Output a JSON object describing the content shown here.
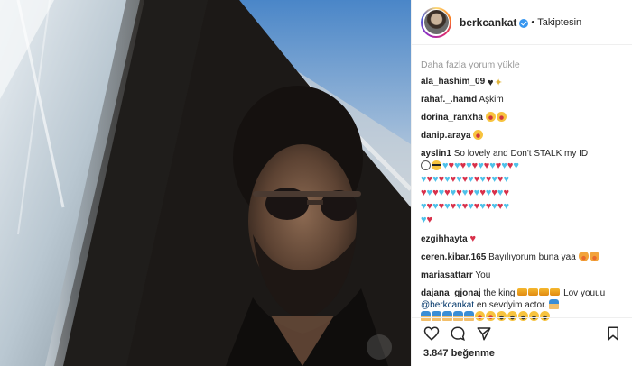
{
  "post": {
    "username": "berkcankat",
    "follow_status": "Takiptesin",
    "likes": "3.847 beğenme"
  },
  "comments_more": "Daha fazla yorum yükle",
  "comments": [
    {
      "user": "ala_hashim_09",
      "text": ""
    },
    {
      "user": "rahaf._.hamd",
      "text": "Aşkim"
    },
    {
      "user": "dorina_ranxha",
      "text": ""
    },
    {
      "user": "danip.araya",
      "text": ""
    },
    {
      "user": "ayslin1",
      "text": "So lovely and Don't STALK my ID"
    },
    {
      "user": "ezgihhayta",
      "text": ""
    },
    {
      "user": "ceren.kibar.165",
      "text": "Bayılıyorum buna yaa"
    },
    {
      "user": "mariasattarr",
      "text": "You"
    },
    {
      "user": "dajana_gjonaj",
      "text": "the king",
      "text2": "Lov youuu",
      "mention": "@berkcankat",
      "text3": "en sevdyim actor."
    }
  ],
  "icons": [
    "heart-icon",
    "comment-icon",
    "share-icon",
    "bookmark-icon",
    "verified-icon"
  ],
  "colors": {
    "accent": "#3897f0",
    "text": "#262626",
    "muted": "#999999",
    "mention": "#003569"
  }
}
